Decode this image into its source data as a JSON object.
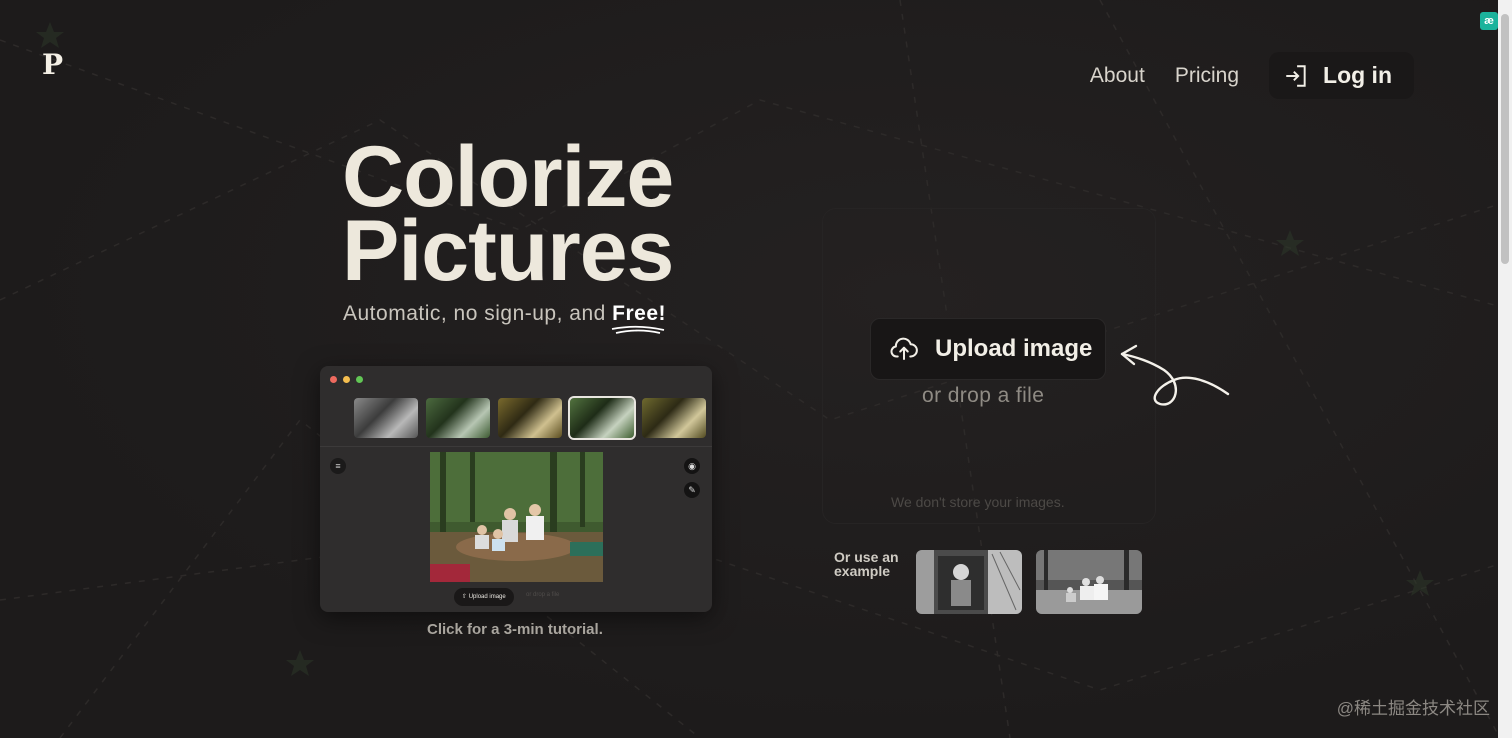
{
  "logo": {
    "text": "P"
  },
  "nav": {
    "about": "About",
    "pricing": "Pricing",
    "login": "Log in"
  },
  "hero": {
    "title_line1": "Colorize",
    "title_line2": "Pictures",
    "subtitle": "Automatic, no sign-up, and ",
    "subtitle_emphasis": "Free!"
  },
  "demo": {
    "upload_label": "Upload image",
    "drop_label": "or drop a file",
    "tutorial": "Click for a 3-min tutorial."
  },
  "upload": {
    "button": "Upload image",
    "drop": "or drop a file",
    "privacy": "We don't store your images."
  },
  "examples": {
    "label": "Or use an example"
  },
  "badge": {
    "text": "æ"
  },
  "watermark": {
    "text": "@稀土掘金技术社区"
  },
  "colors": {
    "background": "#1f1d1d",
    "accent": "#ede8dc",
    "badge": "#1bb39c"
  }
}
